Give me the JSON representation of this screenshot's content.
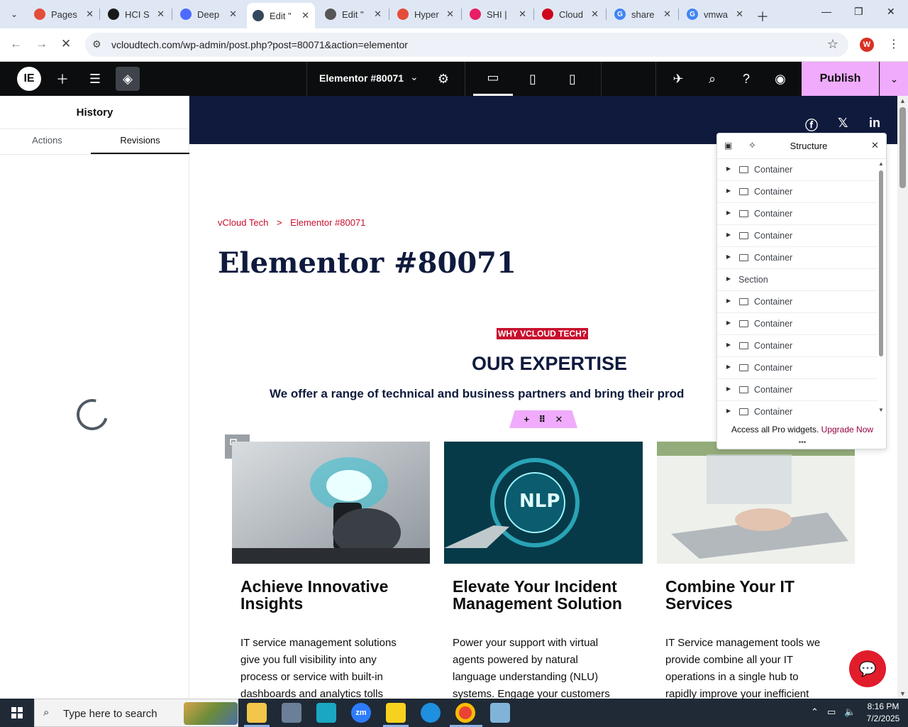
{
  "browser": {
    "tabs": [
      {
        "title": "Pages",
        "favicon_color": "#e44c3a",
        "active": false
      },
      {
        "title": "HCI S",
        "favicon_color": "#1a1a1a",
        "active": false
      },
      {
        "title": "Deep",
        "favicon_color": "#4d6bfe",
        "active": false
      },
      {
        "title": "Edit \"",
        "favicon_color": "#33485d",
        "active": true
      },
      {
        "title": "Edit \"",
        "favicon_color": "#555555",
        "active": false
      },
      {
        "title": "Hyper",
        "favicon_color": "#e44c3a",
        "active": false
      },
      {
        "title": "SHI |",
        "favicon_color": "#e91e63",
        "active": false
      },
      {
        "title": "Cloud",
        "favicon_color": "#d0021b",
        "active": false
      },
      {
        "title": "share",
        "favicon_color": "#4285f4",
        "active": false
      },
      {
        "title": "vmwa",
        "favicon_color": "#4285f4",
        "active": false
      }
    ],
    "url": "vcloudtech.com/wp-admin/post.php?post=80071&action=elementor",
    "profile_initial": "W"
  },
  "editor": {
    "document_title": "Elementor #80071",
    "publish_label": "Publish"
  },
  "left_panel": {
    "title": "History",
    "tabs": [
      "Actions",
      "Revisions"
    ],
    "active_tab": "Revisions"
  },
  "canvas": {
    "breadcrumbs": [
      "vCloud Tech",
      ">",
      "Elementor #80071"
    ],
    "page_title": "Elementor #80071",
    "eyebrow": "WHY VCLOUD TECH?",
    "heading": "OUR EXPERTISE",
    "tagline": "We offer a range of technical and business partners and bring their prod",
    "cards": [
      {
        "title_line1": "Achieve Innovative",
        "title_line2": "Insights",
        "text": [
          "IT service management solutions",
          "give you full visibility into any",
          "process or service with built-in",
          "dashboards and analytics tolls"
        ]
      },
      {
        "title_line1": "Elevate Your Incident",
        "title_line2": "Management Solution",
        "text": [
          "Power your support with virtual",
          "agents powered by natural",
          "language understanding (NLU)",
          "systems. Engage your customers"
        ]
      },
      {
        "title_line1": "Combine Your IT",
        "title_line2": "Services",
        "text": [
          "IT Service management tools we",
          "provide combine all your IT",
          "operations in a single hub to",
          "rapidly improve your inefficient"
        ]
      }
    ]
  },
  "structure_panel": {
    "title": "Structure",
    "items": [
      "Container",
      "Container",
      "Container",
      "Container",
      "Container",
      "Section",
      "Container",
      "Container",
      "Container",
      "Container",
      "Container",
      "Container"
    ],
    "promo_text": "Access all Pro widgets.",
    "promo_link": "Upgrade Now"
  },
  "taskbar": {
    "search_placeholder": "Type here to search",
    "time": "8:16 PM",
    "date": "7/2/2025"
  },
  "colors": {
    "accent_pink": "#f0abfc",
    "brand_navy": "#0f1a3d",
    "brand_red": "#c8102e"
  }
}
